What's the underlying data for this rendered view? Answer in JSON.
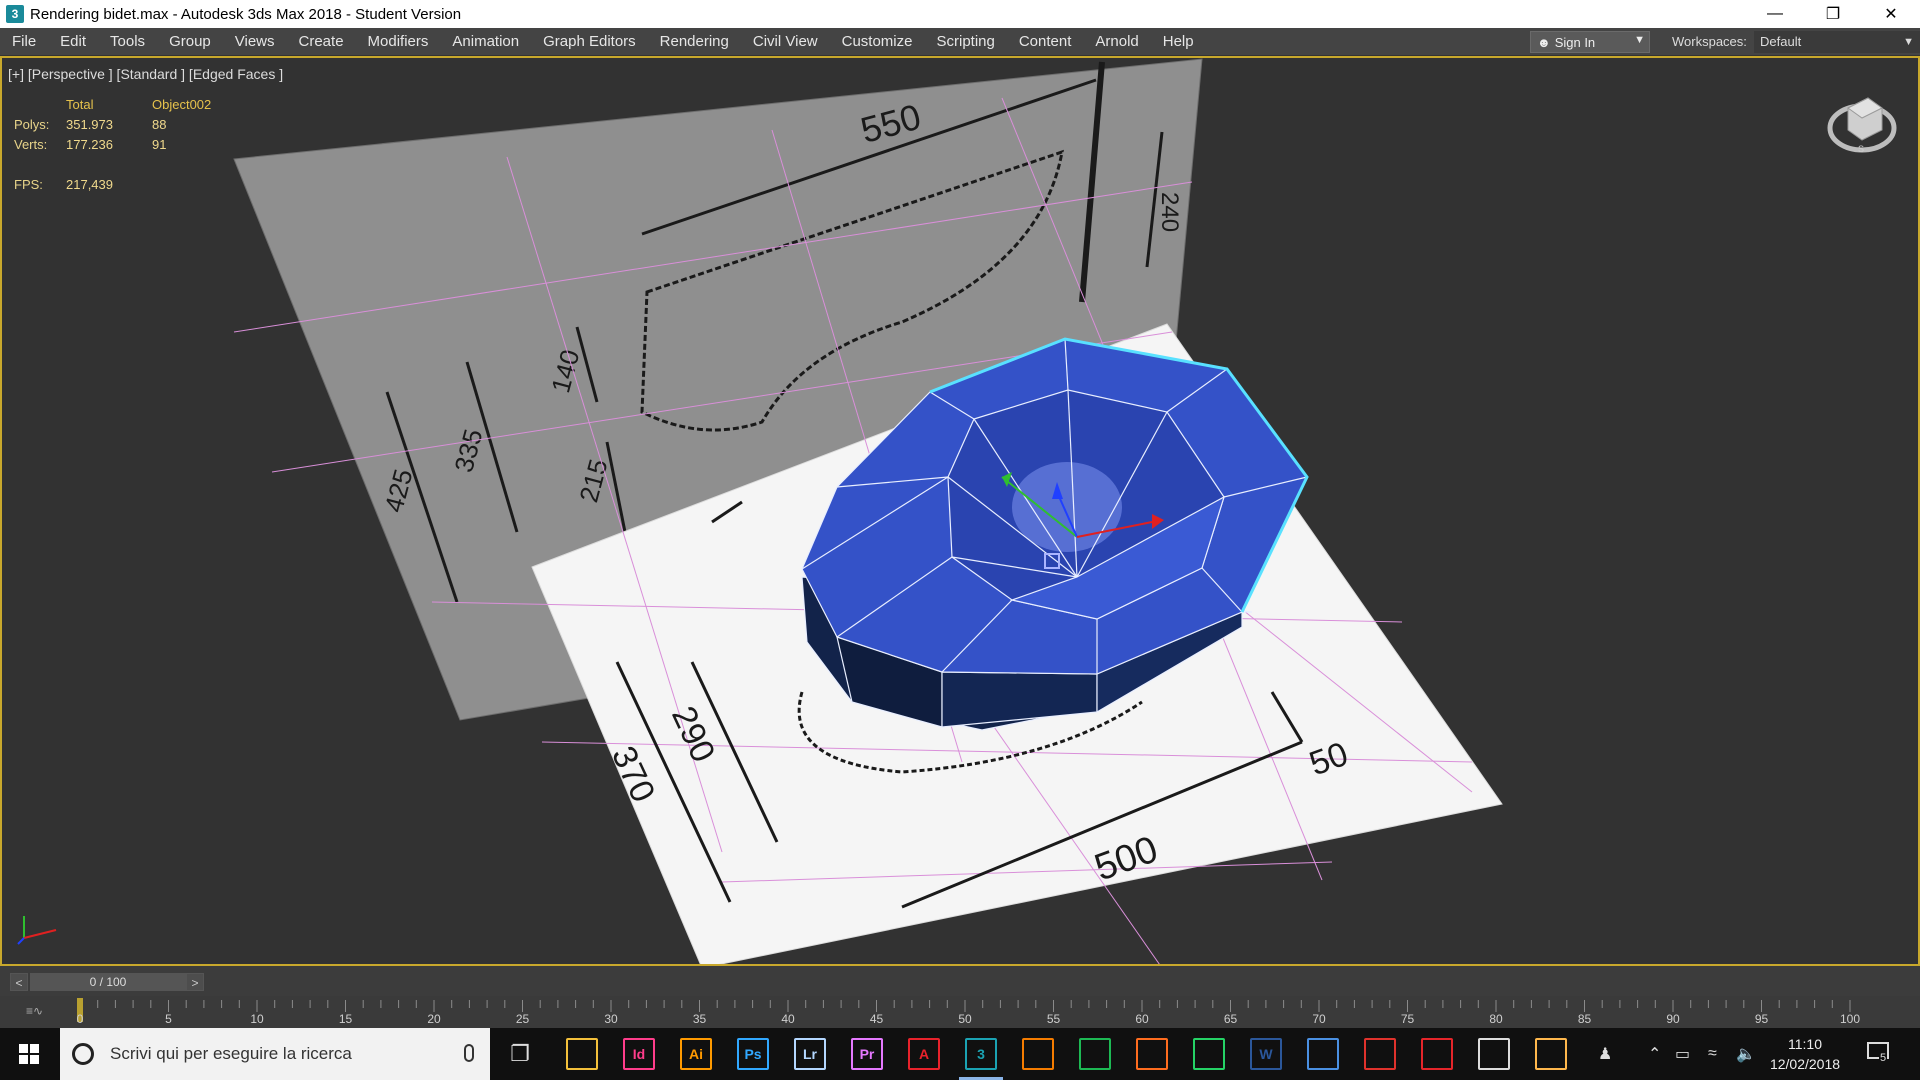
{
  "window": {
    "title": "Rendering bidet.max - Autodesk 3ds Max 2018 - Student Version",
    "app_icon": "3"
  },
  "menu": {
    "items": [
      "File",
      "Edit",
      "Tools",
      "Group",
      "Views",
      "Create",
      "Modifiers",
      "Animation",
      "Graph Editors",
      "Rendering",
      "Civil View",
      "Customize",
      "Scripting",
      "Content",
      "Arnold",
      "Help"
    ],
    "sign_in": "Sign In",
    "workspaces_label": "Workspaces:",
    "workspace_value": "Default"
  },
  "viewport": {
    "label": "[+] [Perspective ] [Standard ] [Edged Faces ]",
    "stats": {
      "header_total": "Total",
      "header_object": "Object002",
      "polys_label": "Polys:",
      "polys_total": "351.973",
      "polys_object": "88",
      "verts_label": "Verts:",
      "verts_total": "177.236",
      "verts_object": "91",
      "fps_label": "FPS:",
      "fps_value": "217,439"
    },
    "dimensions": {
      "top_width": "550",
      "depth_a": "140",
      "height_a": "335",
      "height_b": "215",
      "height_c": "425",
      "side": "240",
      "bottom_width": "500",
      "bottom_a": "370",
      "bottom_b": "290",
      "bottom_c": "50"
    },
    "object_color": "#3452c8",
    "selection_color": "#59e1ff",
    "border_color": "#c8a82c"
  },
  "timeline": {
    "frame_display": "0 / 100",
    "prev": "<",
    "next": ">",
    "ticks": [
      "0",
      "5",
      "10",
      "15",
      "20",
      "25",
      "30",
      "35",
      "40",
      "45",
      "50",
      "55",
      "60",
      "65",
      "70",
      "75",
      "80",
      "85",
      "90",
      "95",
      "100"
    ]
  },
  "taskbar": {
    "search_placeholder": "Scrivi qui per eseguire la ricerca",
    "apps": [
      {
        "name": "file-explorer",
        "label": "",
        "color": "#f3c03b"
      },
      {
        "name": "indesign",
        "label": "Id",
        "color": "#ff3d8b"
      },
      {
        "name": "illustrator",
        "label": "Ai",
        "color": "#ff9a00"
      },
      {
        "name": "photoshop",
        "label": "Ps",
        "color": "#31a8ff"
      },
      {
        "name": "lightroom",
        "label": "Lr",
        "color": "#b4d7ff"
      },
      {
        "name": "premiere",
        "label": "Pr",
        "color": "#e579ff"
      },
      {
        "name": "autocad",
        "label": "A",
        "color": "#e8222b"
      },
      {
        "name": "3ds-max",
        "label": "3",
        "color": "#1ba3b3"
      },
      {
        "name": "blender",
        "label": "",
        "color": "#f57c00"
      },
      {
        "name": "spotify",
        "label": "",
        "color": "#1db954"
      },
      {
        "name": "firefox",
        "label": "",
        "color": "#ff6d1f"
      },
      {
        "name": "whatsapp",
        "label": "",
        "color": "#25d366"
      },
      {
        "name": "word",
        "label": "W",
        "color": "#2b579a"
      },
      {
        "name": "store",
        "label": "",
        "color": "#4a90e2"
      },
      {
        "name": "sketchup",
        "label": "",
        "color": "#e0322c"
      },
      {
        "name": "acrobat",
        "label": "",
        "color": "#e5252a"
      },
      {
        "name": "photos",
        "label": "",
        "color": "#dddddd"
      },
      {
        "name": "paint",
        "label": "",
        "color": "#ffb84d"
      }
    ],
    "clock_time": "11:10",
    "clock_date": "12/02/2018",
    "notifications": "5"
  }
}
